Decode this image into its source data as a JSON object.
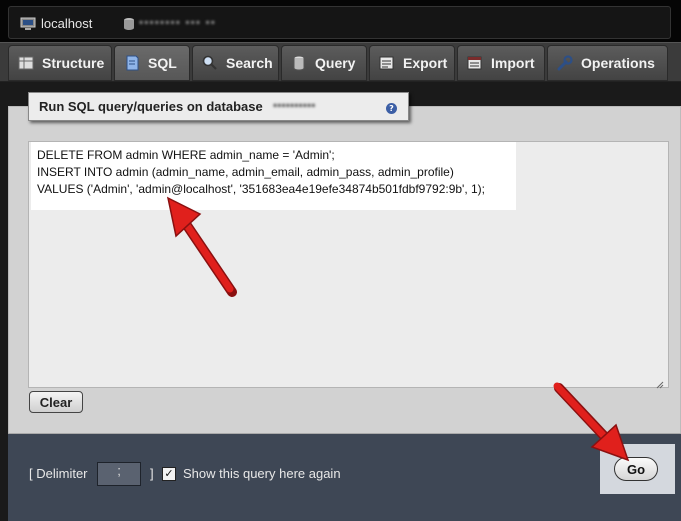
{
  "topbar": {
    "host_label": "localhost",
    "db_label": "▪▪▪▪▪▪▪▪  ▪▪▪  ▪▪"
  },
  "tabs": [
    {
      "label": "Structure",
      "icon": "structure-icon"
    },
    {
      "label": "SQL",
      "icon": "sql-icon",
      "active": true
    },
    {
      "label": "Search",
      "icon": "search-icon"
    },
    {
      "label": "Query",
      "icon": "query-icon"
    },
    {
      "label": "Export",
      "icon": "export-icon"
    },
    {
      "label": "Import",
      "icon": "import-icon"
    },
    {
      "label": "Operations",
      "icon": "operations-icon"
    }
  ],
  "legend": {
    "text": "Run SQL query/queries on database",
    "db_name": "▪▪▪▪▪▪▪▪▪▪"
  },
  "sql": {
    "lines": [
      "DELETE FROM admin WHERE admin_name = 'Admin';",
      "INSERT INTO admin (admin_name, admin_email, admin_pass, admin_profile)",
      "VALUES ('Admin', 'admin@localhost', '351683ea4e19efe34874b501fdbf9792:9b', 1);"
    ]
  },
  "buttons": {
    "clear": "Clear",
    "go": "Go"
  },
  "bottom": {
    "delimiter_label": "[ Delimiter",
    "delimiter_value": ";",
    "delimiter_close": "]",
    "show_check": "✓",
    "show_label": "Show this query here again"
  },
  "colors": {
    "arrow": "#e0201c",
    "bottom_bar": "#3e4755"
  }
}
